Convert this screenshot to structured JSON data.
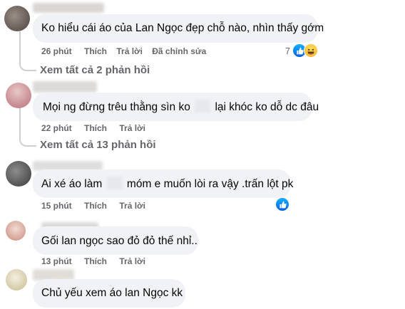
{
  "comments": [
    {
      "text": "Ko hiểu cái áo của Lan Ngọc đẹp chỗ nào, nhìn thấy gớm",
      "time": "26 phút",
      "like": "Thích",
      "reply": "Trả lời",
      "edited": "Đã chỉnh sửa",
      "reaction_count": "7",
      "view_replies": "Xem tất cả 2 phản hồi"
    },
    {
      "text_before": "Mọi ng đừng trêu thằng sìn ko",
      "text_after": "lại khóc ko dỗ dc đâu",
      "time": "22 phút",
      "like": "Thích",
      "reply": "Trả lời",
      "view_replies": "Xem tất cả 13 phản hồi"
    },
    {
      "text_before": "Ai xé áo làm",
      "text_after": "móm e muốn lòi ra vậy .trấn lột pk",
      "time": "15 phút",
      "like": "Thích",
      "reply": "Trả lời"
    },
    {
      "text": "Gối lan ngọc sao đỏ đỏ thế nhỉ..",
      "time": "13 phút",
      "like": "Thích",
      "reply": "Trả lời"
    },
    {
      "text": "Chủ yếu xem áo lan Ngọc kk"
    }
  ],
  "colors": {
    "bubble": "#f0f2f5",
    "meta_text": "#65676b",
    "thread_line": "#ced0d4",
    "like_blue": "#0866ff",
    "haha_yellow": "#f7b125"
  },
  "icons": [
    "like-reaction-icon",
    "haha-reaction-icon"
  ]
}
